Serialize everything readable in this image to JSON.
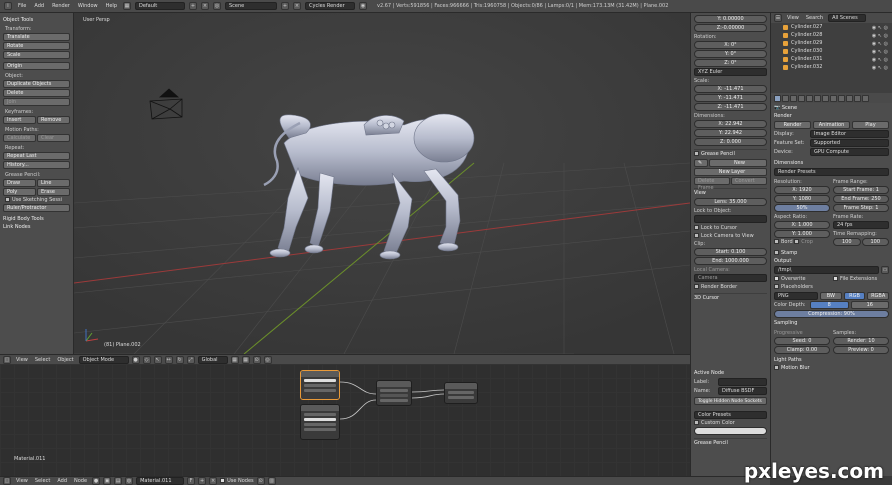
{
  "topbar": {
    "menus": [
      "File",
      "Add",
      "Render",
      "Window",
      "Help"
    ],
    "layout": "Default",
    "scene": "Scene",
    "engine": "Cycles Render",
    "stats": "v2.67 | Verts:591856 | Faces:966666 | Tris:1960758 | Objects:0/86 | Lamps:0/1 | Mem:173.13M (31.42M) | Plane.002"
  },
  "tools": {
    "title": "Object Tools",
    "transform": {
      "label": "Transform:",
      "buttons": [
        "Translate",
        "Rotate",
        "Scale"
      ],
      "origin": "Origin"
    },
    "object": {
      "label": "Object:",
      "buttons": [
        "Duplicate Objects",
        "Delete",
        "Join"
      ]
    },
    "keyframes": {
      "label": "Keyframes:",
      "insert": "Insert",
      "remove": "Remove"
    },
    "motion": {
      "label": "Motion Paths:",
      "calc": "Calculate",
      "clear": "Clear"
    },
    "repeat": {
      "label": "Repeat:",
      "last": "Repeat Last",
      "history": "History..."
    },
    "grease": {
      "label": "Grease Pencil:",
      "draw": "Draw",
      "line": "Line",
      "poly": "Poly",
      "erase": "Erase",
      "sketch": "Use Sketching Sessi",
      "ruler": "Ruler/Protractor"
    },
    "rigid": "Rigid Body Tools",
    "link": "Link Nodes"
  },
  "viewport": {
    "label": "User Persp",
    "object_label": "(81) Plane.002"
  },
  "vp_header": {
    "view": "View",
    "select": "Select",
    "object": "Object",
    "mode": "Object Mode",
    "orientation": "Global"
  },
  "vprops": {
    "location": {
      "y": "Y: 0.00000",
      "z": "Z:-0.00000"
    },
    "rotation": {
      "label": "Rotation:",
      "x": "X: 0°",
      "y": "Y: 0°",
      "z": "Z: 0°",
      "mode": "XYZ Euler"
    },
    "scale": {
      "label": "Scale:",
      "x": "X: -11.471",
      "y": "Y: -11.471",
      "z": "Z: -11.471"
    },
    "dimensions": {
      "label": "Dimensions:",
      "x": "X: 22.942",
      "y": "Y: 22.942",
      "z": "Z: 0.000"
    },
    "grease": {
      "title": "Grease Pencil",
      "new": "New",
      "new_layer": "New Layer",
      "delete_frame": "Delete Frame",
      "convert": "Convert"
    },
    "view": {
      "title": "View",
      "lens": "Lens: 35.000",
      "lock_label": "Lock to Object:",
      "lock_cursor": "Lock to Cursor",
      "lock_camera": "Lock Camera to View",
      "clip_label": "Clip:",
      "start": "Start: 0.100",
      "end": "End: 1000.000",
      "local_camera": "Local Camera:",
      "camera": "Camera",
      "render_border": "Render Border",
      "cursor3d": "3D Cursor"
    }
  },
  "nprops": {
    "title": "Active Node",
    "label": "Label:",
    "name_label": "Name:",
    "name": "Diffuse BSDF",
    "toggle": "Toggle Hidden Node Sockets",
    "presets": "Color Presets",
    "custom": "Custom Color",
    "grease": "Grease Pencil"
  },
  "node_editor": {
    "material": "Material.011"
  },
  "bottom": {
    "view": "View",
    "select": "Select",
    "add": "Add",
    "node": "Node",
    "material": "Material.011",
    "use_nodes": "Use Nodes"
  },
  "outliner": {
    "view": "View",
    "search": "Search",
    "scenes": "All Scenes",
    "items": [
      "Cylinder.027",
      "Cylinder.028",
      "Cylinder.029",
      "Cylinder.030",
      "Cylinder.031",
      "Cylinder.032"
    ]
  },
  "props": {
    "scene": "Scene",
    "render": {
      "title": "Render",
      "render": "Render",
      "animation": "Animation",
      "play": "Play",
      "display_label": "Display:",
      "display": "Image Editor",
      "feature_label": "Feature Set:",
      "feature": "Supported",
      "device_label": "Device:",
      "device": "GPU Compute"
    },
    "dimensions": {
      "title": "Dimensions",
      "presets": "Render Presets",
      "resolution": "Resolution:",
      "res_x": "X: 1920",
      "res_y": "Y: 1080",
      "pct": "50%",
      "frame_range": "Frame Range:",
      "start": "Start Frame: 1",
      "end": "End Frame: 250",
      "step": "Frame Step: 1",
      "aspect": "Aspect Ratio:",
      "asp_x": "X: 1.000",
      "asp_y": "Y: 1.000",
      "border": "Bord",
      "crop": "Crop",
      "frame_rate": "Frame Rate:",
      "fps": "24 fps",
      "remap": "Time Remapping:",
      "old": "100",
      "new": "100"
    },
    "stamp": "Stamp",
    "output": {
      "title": "Output",
      "path": "/tmp\\",
      "overwrite": "Overwrite",
      "extensions": "File Extensions",
      "placeholders": "Placeholders",
      "format": "PNG",
      "bw": "BW",
      "rgb": "RGB",
      "rgba": "RGBA",
      "depth_label": "Color Depth:",
      "d8": "8",
      "d16": "16",
      "compression": "Compression: 90%"
    },
    "sampling": {
      "title": "Sampling",
      "progressive": "Progressive",
      "samples": "Samples:",
      "seed": "Seed: 0",
      "clamp": "Clamp: 0.00",
      "render": "Render: 10",
      "preview": "Preview: 0"
    },
    "light": "Light Paths",
    "motion": "Motion Blur"
  },
  "watermark": "pxleyes.com",
  "colors": {
    "accent": "#5680c2",
    "grid_red": "#9c3a3a",
    "grid_green": "#6b8f2a",
    "model": "#b7bccd"
  }
}
